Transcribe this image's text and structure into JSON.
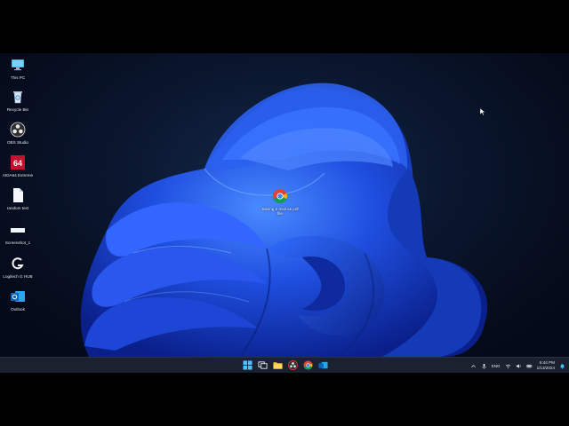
{
  "desktop": {
    "icons": [
      {
        "label": "This PC",
        "icon": "monitor-icon"
      },
      {
        "label": "Recycle Bin",
        "icon": "recycle-bin-icon"
      },
      {
        "label": "OBS Studio",
        "icon": "obs-icon"
      },
      {
        "label": "AIDA64 Extreme",
        "icon": "aida64-icon"
      },
      {
        "label": "random text",
        "icon": "text-file-icon"
      },
      {
        "label": "Screenshot_1",
        "icon": "image-file-icon"
      },
      {
        "label": "Logitech G HUB",
        "icon": "logitech-icon"
      },
      {
        "label": "Outlook",
        "icon": "outlook-icon"
      }
    ],
    "center_icon": {
      "label": "Saving e mail as pdf file",
      "icon": "chrome-icon"
    }
  },
  "taskbar": {
    "apps": [
      "windows-start-icon",
      "task-view-icon",
      "file-explorer-icon",
      "obs-icon",
      "chrome-icon",
      "outlook-icon"
    ],
    "tray": {
      "language": "ENG",
      "time": "6:44 PM",
      "date": "1/13/2024"
    }
  },
  "colors": {
    "wallpaper_bg": "#0b1730",
    "bloom_blue": "#1f4fe0",
    "taskbar": "#1c2130"
  }
}
